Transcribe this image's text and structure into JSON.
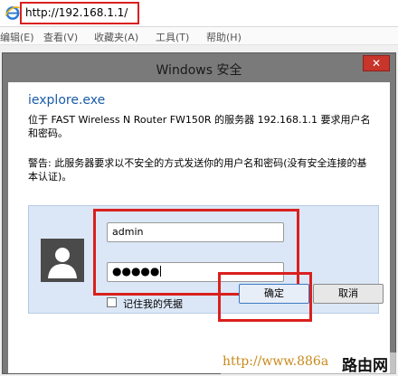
{
  "browser": {
    "address": "http://192.168.1.1/",
    "menu": [
      "编辑(E)",
      "查看(V)",
      "收藏夹(A)",
      "工具(T)",
      "帮助(H)"
    ]
  },
  "dialog": {
    "title": "Windows 安全",
    "close_glyph": "✕",
    "app_name": "iexplore.exe",
    "info": "位于 FAST Wireless N Router FW150R 的服务器 192.168.1.1 要求用户名和密码。",
    "warning": "警告: 此服务器要求以不安全的方式发送你的用户名和密码(没有安全连接的基本认证)。",
    "username": "admin",
    "password_mask": "●●●●●",
    "remember_label": "记住我的凭据",
    "ok_label": "确定",
    "cancel_label": "取消"
  },
  "watermark": {
    "url": "http://www.886a",
    "brand": "路由网"
  },
  "colors": {
    "highlight": "#d9201e",
    "link_blue": "#1a5ca8",
    "panel_blue": "#dbe7f6",
    "close_red": "#c7352b",
    "titlebar_gray": "#7a7a7a"
  },
  "icons": [
    "ie-logo-icon",
    "close-icon",
    "user-avatar-icon",
    "checkbox-icon"
  ]
}
